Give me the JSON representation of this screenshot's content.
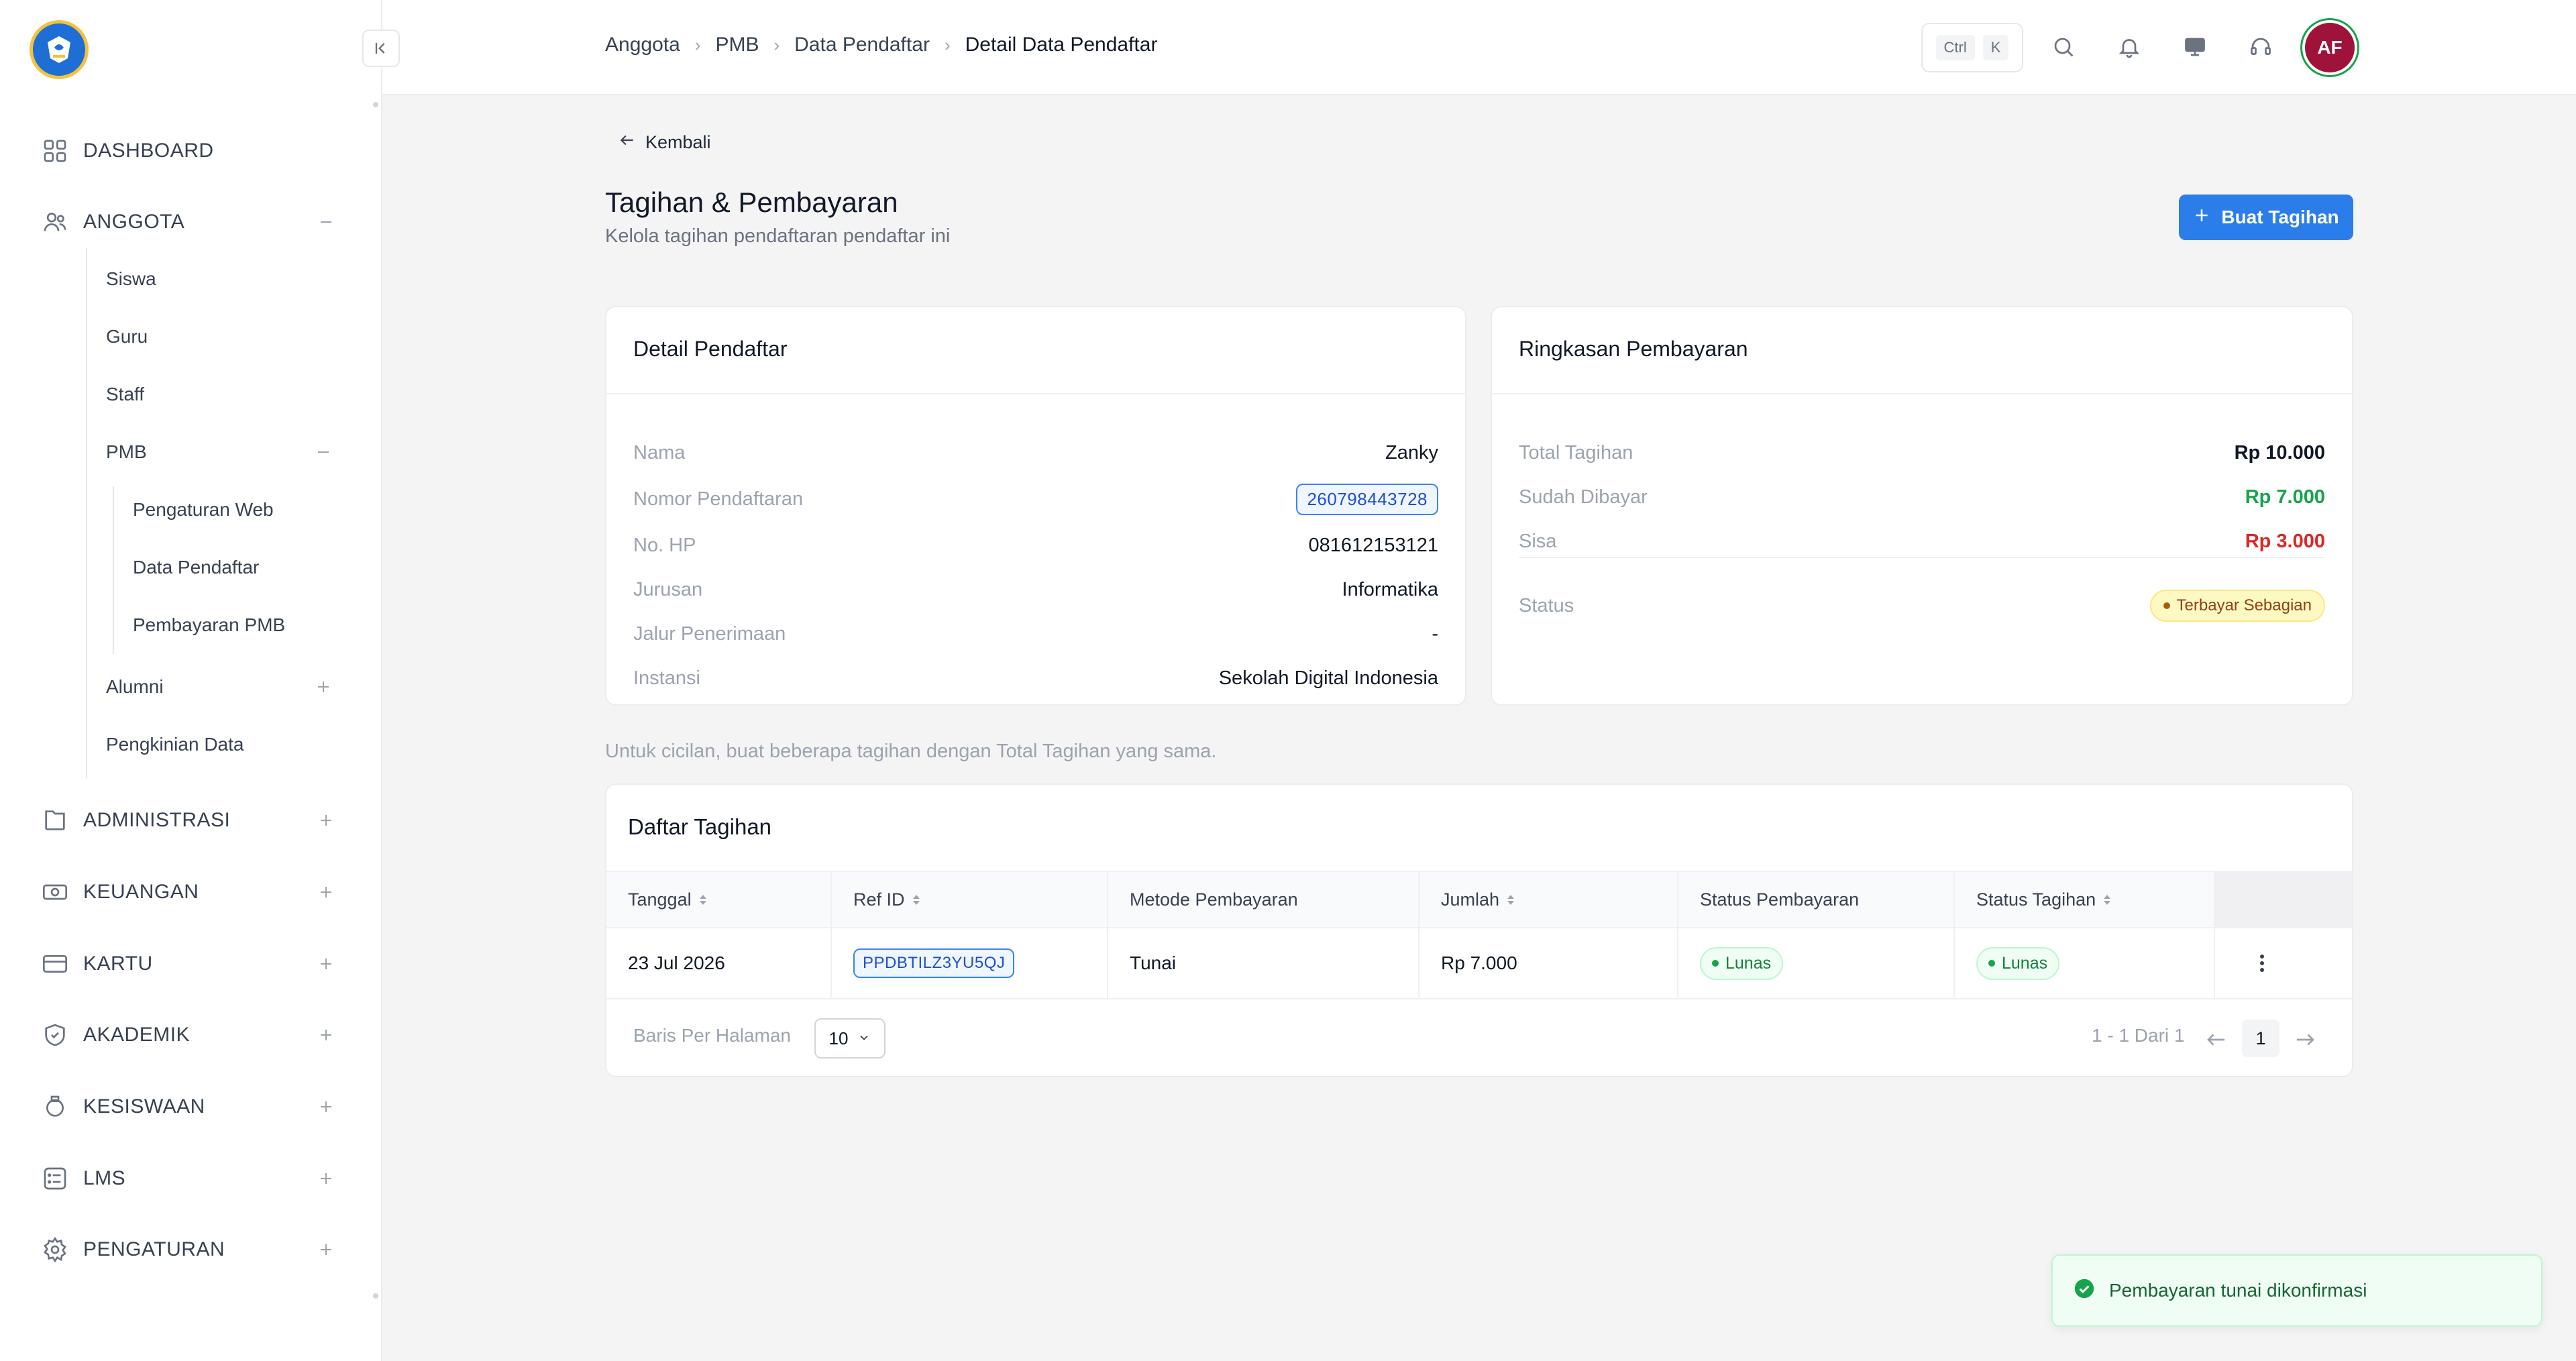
{
  "sidebar": {
    "items": [
      {
        "label": "DASHBOARD",
        "icon": "grid-icon"
      },
      {
        "label": "ANGGOTA",
        "icon": "users-icon",
        "expanded": true
      },
      {
        "label": "ADMINISTRASI",
        "icon": "folder-icon"
      },
      {
        "label": "KEUANGAN",
        "icon": "banknote-icon"
      },
      {
        "label": "KARTU",
        "icon": "card-icon"
      },
      {
        "label": "AKADEMIK",
        "icon": "shield-icon"
      },
      {
        "label": "KESISWAAN",
        "icon": "badge-icon"
      },
      {
        "label": "LMS",
        "icon": "list-icon"
      },
      {
        "label": "PENGATURAN",
        "icon": "gear-icon"
      }
    ],
    "anggota_children": [
      "Siswa",
      "Guru",
      "Staff",
      "PMB",
      "Alumni",
      "Pengkinian Data"
    ],
    "pmb_children": [
      "Pengaturan Web",
      "Data Pendaftar",
      "Pembayaran PMB"
    ]
  },
  "header": {
    "breadcrumb": [
      "Anggota",
      "PMB",
      "Data Pendaftar",
      "Detail Data Pendaftar"
    ],
    "kbd": [
      "Ctrl",
      "K"
    ],
    "avatar": "AF"
  },
  "main": {
    "back": "Kembali",
    "title": "Tagihan & Pembayaran",
    "subtitle": "Kelola tagihan pendaftaran pendaftar ini",
    "create_button": "Buat Tagihan",
    "hint": "Untuk cicilan, buat beberapa tagihan dengan Total Tagihan yang sama."
  },
  "detail": {
    "title": "Detail Pendaftar",
    "rows": [
      {
        "label": "Nama",
        "value": "Zanky"
      },
      {
        "label": "Nomor Pendaftaran",
        "value": "260798443728"
      },
      {
        "label": "No. HP",
        "value": "081612153121"
      },
      {
        "label": "Jurusan",
        "value": "Informatika"
      },
      {
        "label": "Jalur Penerimaan",
        "value": "-"
      },
      {
        "label": "Instansi",
        "value": "Sekolah Digital Indonesia"
      }
    ]
  },
  "summary": {
    "title": "Ringkasan Pembayaran",
    "rows": [
      {
        "label": "Total Tagihan",
        "value": "Rp 10.000"
      },
      {
        "label": "Sudah Dibayar",
        "value": "Rp 7.000"
      },
      {
        "label": "Sisa",
        "value": "Rp 3.000"
      }
    ],
    "status_label": "Status",
    "status_value": "Terbayar Sebagian"
  },
  "table": {
    "title": "Daftar Tagihan",
    "columns": [
      "Tanggal",
      "Ref ID",
      "Metode Pembayaran",
      "Jumlah",
      "Status Pembayaran",
      "Status Tagihan"
    ],
    "rows": [
      {
        "tanggal": "23 Jul 2026",
        "ref": "PPDBTILZ3YU5QJ",
        "metode": "Tunai",
        "jumlah": "Rp 7.000",
        "status_bayar": "Lunas",
        "status_tagihan": "Lunas"
      }
    ],
    "per_page_label": "Baris Per Halaman",
    "per_page_value": "10",
    "range": "1 - 1 Dari 1",
    "page": "1"
  },
  "toast": {
    "message": "Pembayaran tunai dikonfirmasi"
  },
  "colors": {
    "primary": "#2b7de9",
    "success": "#16a34a",
    "danger": "#dc2626",
    "warning": "#fef9c3"
  }
}
